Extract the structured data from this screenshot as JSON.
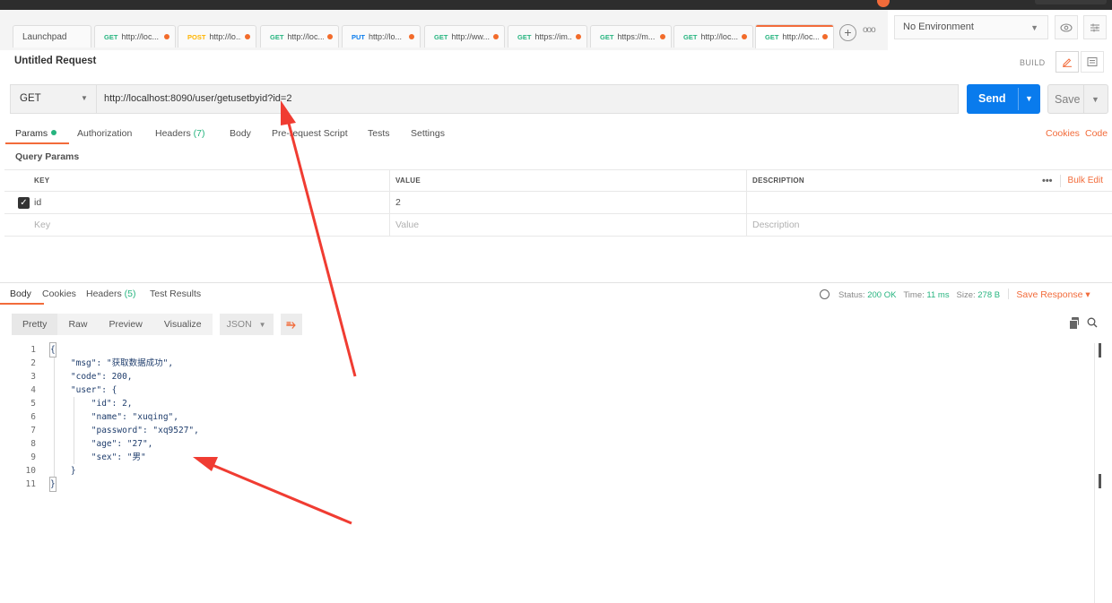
{
  "tabs": [
    {
      "label": "Launchpad"
    },
    {
      "method": "GET",
      "url": "http://loc...",
      "color": "#26b47f"
    },
    {
      "method": "POST",
      "url": "http://lo...",
      "color": "#ffb400"
    },
    {
      "method": "GET",
      "url": "http://loc...",
      "color": "#26b47f"
    },
    {
      "method": "PUT",
      "url": "http://lo...",
      "color": "#097bed"
    },
    {
      "method": "GET",
      "url": "http://ww...",
      "color": "#26b47f"
    },
    {
      "method": "GET",
      "url": "https://im...",
      "color": "#26b47f"
    },
    {
      "method": "GET",
      "url": "https://m...",
      "color": "#26b47f"
    },
    {
      "method": "GET",
      "url": "http://loc...",
      "color": "#26b47f"
    },
    {
      "method": "GET",
      "url": "http://loc...",
      "color": "#26b47f"
    }
  ],
  "environment": {
    "selected": "No Environment"
  },
  "request": {
    "title": "Untitled Request",
    "build_label": "BUILD",
    "method": "GET",
    "url": "http://localhost:8090/user/getusetbyid?id=2",
    "send_label": "Send",
    "save_label": "Save"
  },
  "request_tabs": {
    "params": "Params",
    "authorization": "Authorization",
    "headers": "Headers",
    "headers_count": "(7)",
    "body": "Body",
    "prerequest": "Pre-request Script",
    "tests": "Tests",
    "settings": "Settings",
    "cookies": "Cookies",
    "code": "Code"
  },
  "params": {
    "section_title": "Query Params",
    "columns": {
      "key": "KEY",
      "value": "VALUE",
      "description": "DESCRIPTION"
    },
    "bulk_edit": "Bulk Edit",
    "rows": [
      {
        "key": "id",
        "value": "2",
        "checked": true
      }
    ],
    "placeholders": {
      "key": "Key",
      "value": "Value",
      "description": "Description"
    }
  },
  "response_tabs": {
    "body": "Body",
    "cookies": "Cookies",
    "headers": "Headers",
    "headers_count": "(5)",
    "test_results": "Test Results"
  },
  "response_status": {
    "status_label": "Status:",
    "status_value": "200 OK",
    "time_label": "Time:",
    "time_value": "11 ms",
    "size_label": "Size:",
    "size_value": "278 B",
    "save_response": "Save Response"
  },
  "view_modes": {
    "pretty": "Pretty",
    "raw": "Raw",
    "preview": "Preview",
    "visualize": "Visualize",
    "format": "JSON"
  },
  "response_lines": [
    {
      "n": "1",
      "t": "{"
    },
    {
      "n": "2",
      "t": "    \"msg\": \"获取数据成功\","
    },
    {
      "n": "3",
      "t": "    \"code\": 200,"
    },
    {
      "n": "4",
      "t": "    \"user\": {"
    },
    {
      "n": "5",
      "t": "        \"id\": 2,"
    },
    {
      "n": "6",
      "t": "        \"name\": \"xuqing\","
    },
    {
      "n": "7",
      "t": "        \"password\": \"xq9527\","
    },
    {
      "n": "8",
      "t": "        \"age\": \"27\","
    },
    {
      "n": "9",
      "t": "        \"sex\": \"男\""
    },
    {
      "n": "10",
      "t": "    }"
    },
    {
      "n": "11",
      "t": "}"
    }
  ],
  "colors": {
    "accent": "#f26b3a",
    "send": "#097bed",
    "success": "#26b47f",
    "annotation_arrow": "#f03c32"
  }
}
